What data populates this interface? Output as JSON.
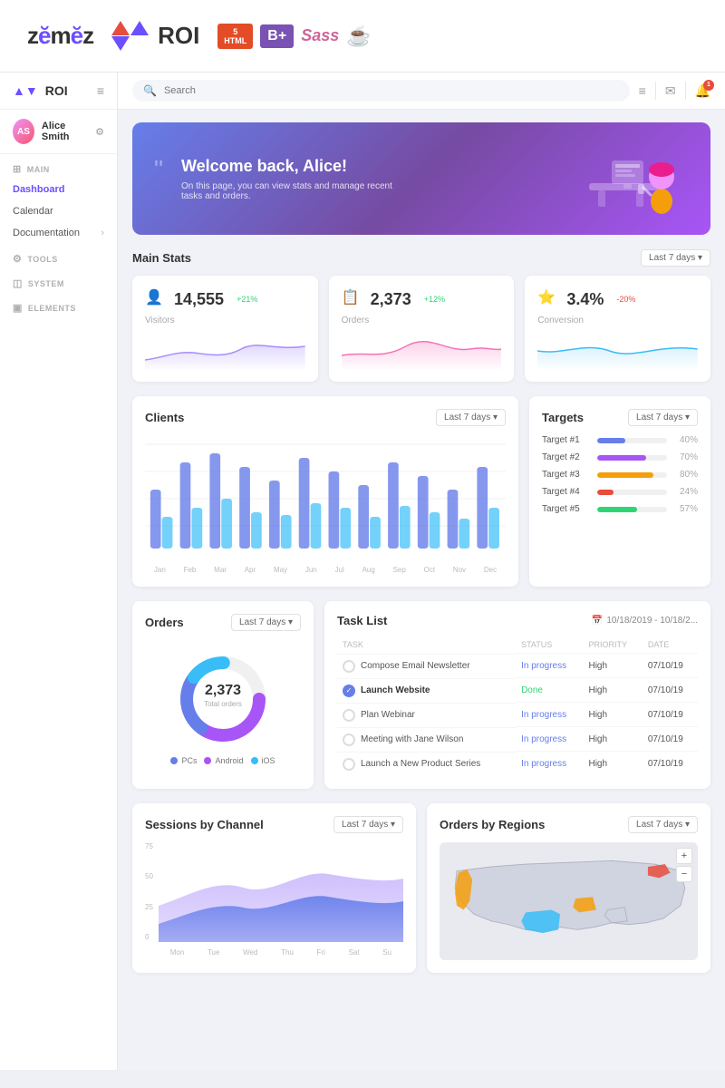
{
  "topbar": {
    "logo_zemes": "zemes",
    "logo_roi": "ROI",
    "tech_html": "HTML",
    "tech_html_version": "5",
    "tech_b": "B+",
    "tech_sass": "Sass",
    "tech_gulp": "gulp"
  },
  "sidebar": {
    "brand": "ROI",
    "hamburger": "≡",
    "user": {
      "name": "Alice Smith",
      "initials": "AS"
    },
    "sections": {
      "main": {
        "title": "MAIN",
        "items": [
          "Dashboard",
          "Calendar",
          "Documentation"
        ]
      },
      "tools": {
        "title": "TooLs"
      },
      "system": {
        "title": "SYSTEM"
      },
      "elements": {
        "title": "ELEMENTS"
      }
    }
  },
  "topbar_search": {
    "placeholder": "Search"
  },
  "welcome": {
    "greeting": "Welcome back, Alice!",
    "subtitle": "On this page, you can view stats and manage recent tasks and orders."
  },
  "main_stats": {
    "title": "Main Stats",
    "filter": "Last 7 days ▾",
    "cards": [
      {
        "value": "14,555",
        "change": "+21%",
        "label": "Visitors",
        "positive": true
      },
      {
        "value": "2,373",
        "change": "+12%",
        "label": "Orders",
        "positive": true
      },
      {
        "value": "3.4%",
        "change": "-20%",
        "label": "Conversion",
        "positive": false
      }
    ]
  },
  "clients": {
    "title": "Clients",
    "filter": "Last 7 days ▾",
    "months": [
      "Jan",
      "Feb",
      "Mar",
      "Apr",
      "May",
      "Jun",
      "Jul",
      "Aug",
      "Sep",
      "Oct",
      "Nov",
      "Dec"
    ]
  },
  "targets": {
    "title": "Targets",
    "filter": "Last 7 days ▾",
    "items": [
      {
        "label": "Target #1",
        "pct": 40,
        "color": "#667eea"
      },
      {
        "label": "Target #2",
        "pct": 70,
        "color": "#a855f7"
      },
      {
        "label": "Target #3",
        "pct": 80,
        "color": "#f59e0b"
      },
      {
        "label": "Target #4",
        "pct": 24,
        "color": "#e74c3c"
      },
      {
        "label": "Target #5",
        "pct": 57,
        "color": "#2ed573"
      }
    ]
  },
  "orders": {
    "title": "Orders",
    "filter": "Last 7 days ▾",
    "total": "2,373",
    "total_label": "Total orders",
    "legend": [
      {
        "label": "PCs",
        "color": "#667eea"
      },
      {
        "label": "Android",
        "color": "#a855f7"
      },
      {
        "label": "iOS",
        "color": "#38bdf8"
      }
    ]
  },
  "task_list": {
    "title": "Task List",
    "date_range": "10/18/2019 - 10/18/2...",
    "columns": [
      "TASK",
      "STATUS",
      "PRIORITY",
      "DATE"
    ],
    "tasks": [
      {
        "name": "Compose Email Newsletter",
        "status": "In progress",
        "priority": "High",
        "date": "07/10/19",
        "done": false
      },
      {
        "name": "Launch Website",
        "status": "Done",
        "priority": "High",
        "date": "07/10/19",
        "done": true
      },
      {
        "name": "Plan Webinar",
        "status": "In progress",
        "priority": "High",
        "date": "07/10/19",
        "done": false
      },
      {
        "name": "Meeting with Jane Wilson",
        "status": "In progress",
        "priority": "High",
        "date": "07/10/19",
        "done": false
      },
      {
        "name": "Launch a New Product Series",
        "status": "In progress",
        "priority": "High",
        "date": "07/10/19",
        "done": false
      }
    ]
  },
  "sessions": {
    "title": "Sessions by Channel",
    "filter": "Last 7 days ▾",
    "y_labels": [
      "75",
      "50",
      "25",
      "0"
    ],
    "x_labels": [
      "Mon",
      "Tue",
      "Wed",
      "Thu",
      "Fri",
      "Sat",
      "Su"
    ]
  },
  "orders_regions": {
    "title": "Orders by Regions",
    "filter": "Last 7 days ▾"
  }
}
